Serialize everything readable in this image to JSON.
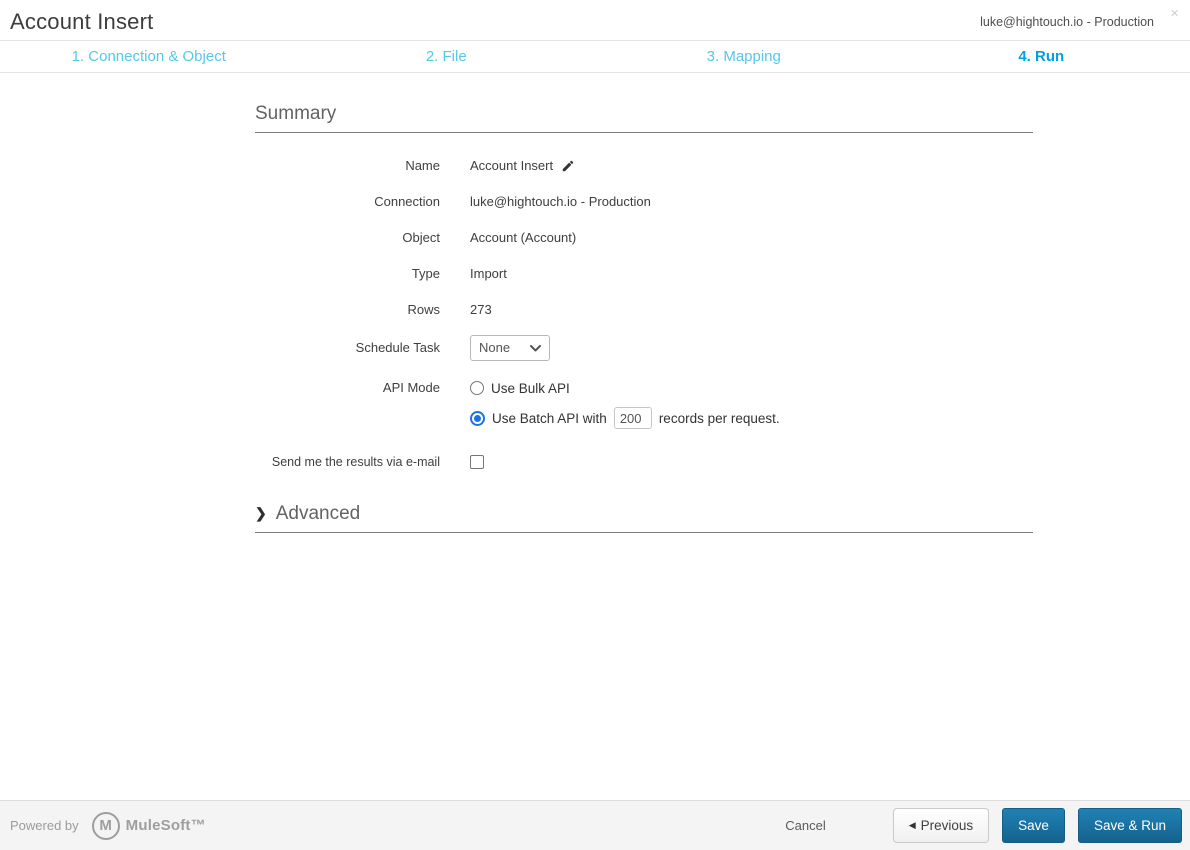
{
  "header": {
    "title": "Account Insert",
    "connection_env": "luke@hightouch.io - Production",
    "close_glyph": "×"
  },
  "steps": [
    {
      "label": "1. Connection & Object",
      "active": false
    },
    {
      "label": "2. File",
      "active": false
    },
    {
      "label": "3. Mapping",
      "active": false
    },
    {
      "label": "4. Run",
      "active": true
    }
  ],
  "summary": {
    "heading": "Summary",
    "name": {
      "label": "Name",
      "value": "Account Insert"
    },
    "connection": {
      "label": "Connection",
      "value": "luke@hightouch.io - Production"
    },
    "object": {
      "label": "Object",
      "value": "Account (Account)"
    },
    "type": {
      "label": "Type",
      "value": "Import"
    },
    "rows": {
      "label": "Rows",
      "value": "273"
    },
    "schedule": {
      "label": "Schedule Task",
      "selected_option": "None"
    },
    "api_mode": {
      "label": "API Mode",
      "bulk_option": "Use Bulk API",
      "batch_prefix": "Use Batch API with",
      "batch_size": "200",
      "batch_suffix": "records per request.",
      "selected": "batch"
    },
    "email": {
      "label": "Send me the results via e-mail",
      "checked": false
    }
  },
  "advanced": {
    "heading": "Advanced",
    "chevron_glyph": "❯",
    "expanded": false
  },
  "footer": {
    "powered_by": "Powered by",
    "logo_letter": "M",
    "brand": "MuleSoft™",
    "cancel_label": "Cancel",
    "previous_arrow": "◀",
    "previous_label": "Previous",
    "save_label": "Save",
    "save_run_label": "Save & Run"
  },
  "colors": {
    "step_inactive": "#57c7ea",
    "step_active": "#00a1df",
    "primary_button": "#1a79a8",
    "radio_selected": "#1a73e8",
    "footer_bg": "#f4f4f4"
  }
}
